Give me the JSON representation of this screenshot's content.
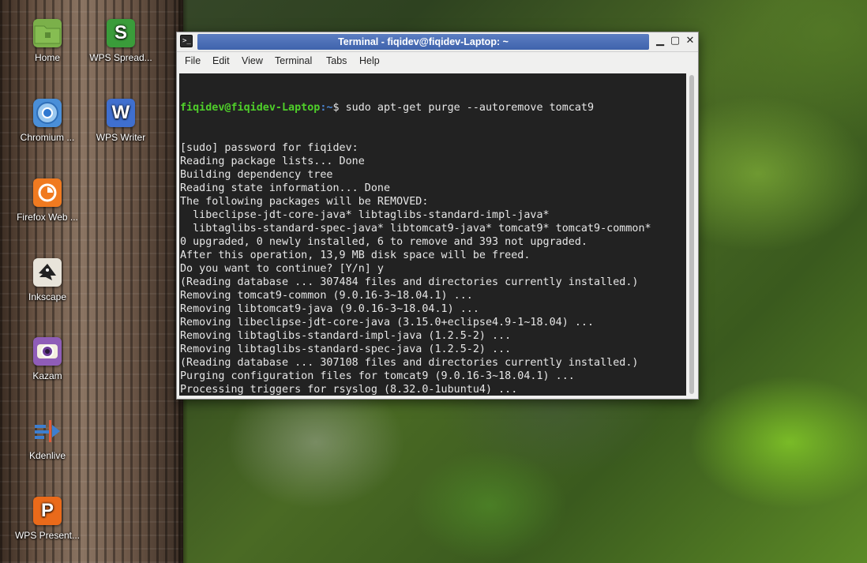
{
  "desktop": {
    "icons": [
      {
        "label": "Home",
        "icon": "folder-icon",
        "color": "#7bb04a",
        "glyph": "▭"
      },
      {
        "label": "WPS Spread...",
        "icon": "wps-spreadsheets-icon",
        "color": "#3a9c3a",
        "glyph": "S"
      },
      {
        "label": "Chromium ...",
        "icon": "chromium-icon",
        "color": "#4a8fd8",
        "glyph": "◉"
      },
      {
        "label": "WPS Writer",
        "icon": "wps-writer-icon",
        "color": "#3f6fcf",
        "glyph": "W"
      },
      {
        "label": "Firefox Web ...",
        "icon": "firefox-icon",
        "color": "#f07a20",
        "glyph": "◔"
      },
      {
        "label": "Inkscape",
        "icon": "inkscape-icon",
        "color": "#e8e4da",
        "glyph": "▲"
      },
      {
        "label": "Kazam",
        "icon": "kazam-icon",
        "color": "#8f5db8",
        "glyph": "◎"
      },
      {
        "label": "Kdenlive",
        "icon": "kdenlive-icon",
        "color": "#3d7fd1",
        "glyph": "▶"
      },
      {
        "label": "WPS Present...",
        "icon": "wps-presentation-icon",
        "color": "#ea6a1a",
        "glyph": "P"
      }
    ]
  },
  "window": {
    "title": "Terminal - fiqidev@fiqidev-Laptop: ~",
    "controls": {
      "minimize": "▁",
      "maximize": "▢",
      "close": "✕"
    },
    "menu": [
      "File",
      "Edit",
      "View",
      "Terminal",
      "Tabs",
      "Help"
    ]
  },
  "terminal": {
    "prompt_user": "fiqidev@fiqidev-Laptop",
    "prompt_path": ":~",
    "prompt_symbol": "$ ",
    "command": "sudo apt-get purge --autoremove tomcat9",
    "output": [
      "[sudo] password for fiqidev:",
      "Reading package lists... Done",
      "Building dependency tree",
      "Reading state information... Done",
      "The following packages will be REMOVED:",
      "  libeclipse-jdt-core-java* libtaglibs-standard-impl-java*",
      "  libtaglibs-standard-spec-java* libtomcat9-java* tomcat9* tomcat9-common*",
      "0 upgraded, 0 newly installed, 6 to remove and 393 not upgraded.",
      "After this operation, 13,9 MB disk space will be freed.",
      "Do you want to continue? [Y/n] y",
      "(Reading database ... 307484 files and directories currently installed.)",
      "Removing tomcat9-common (9.0.16-3~18.04.1) ...",
      "Removing libtomcat9-java (9.0.16-3~18.04.1) ...",
      "Removing libeclipse-jdt-core-java (3.15.0+eclipse4.9-1~18.04) ...",
      "Removing libtaglibs-standard-impl-java (1.2.5-2) ...",
      "Removing libtaglibs-standard-spec-java (1.2.5-2) ...",
      "(Reading database ... 307108 files and directories currently installed.)",
      "Purging configuration files for tomcat9 (9.0.16-3~18.04.1) ...",
      "Processing triggers for rsyslog (8.32.0-1ubuntu4) ..."
    ]
  },
  "colors": {
    "prompt_user": "#4fcf2a",
    "prompt_path": "#4a86d6",
    "titlebar": "#4a6cb5"
  }
}
